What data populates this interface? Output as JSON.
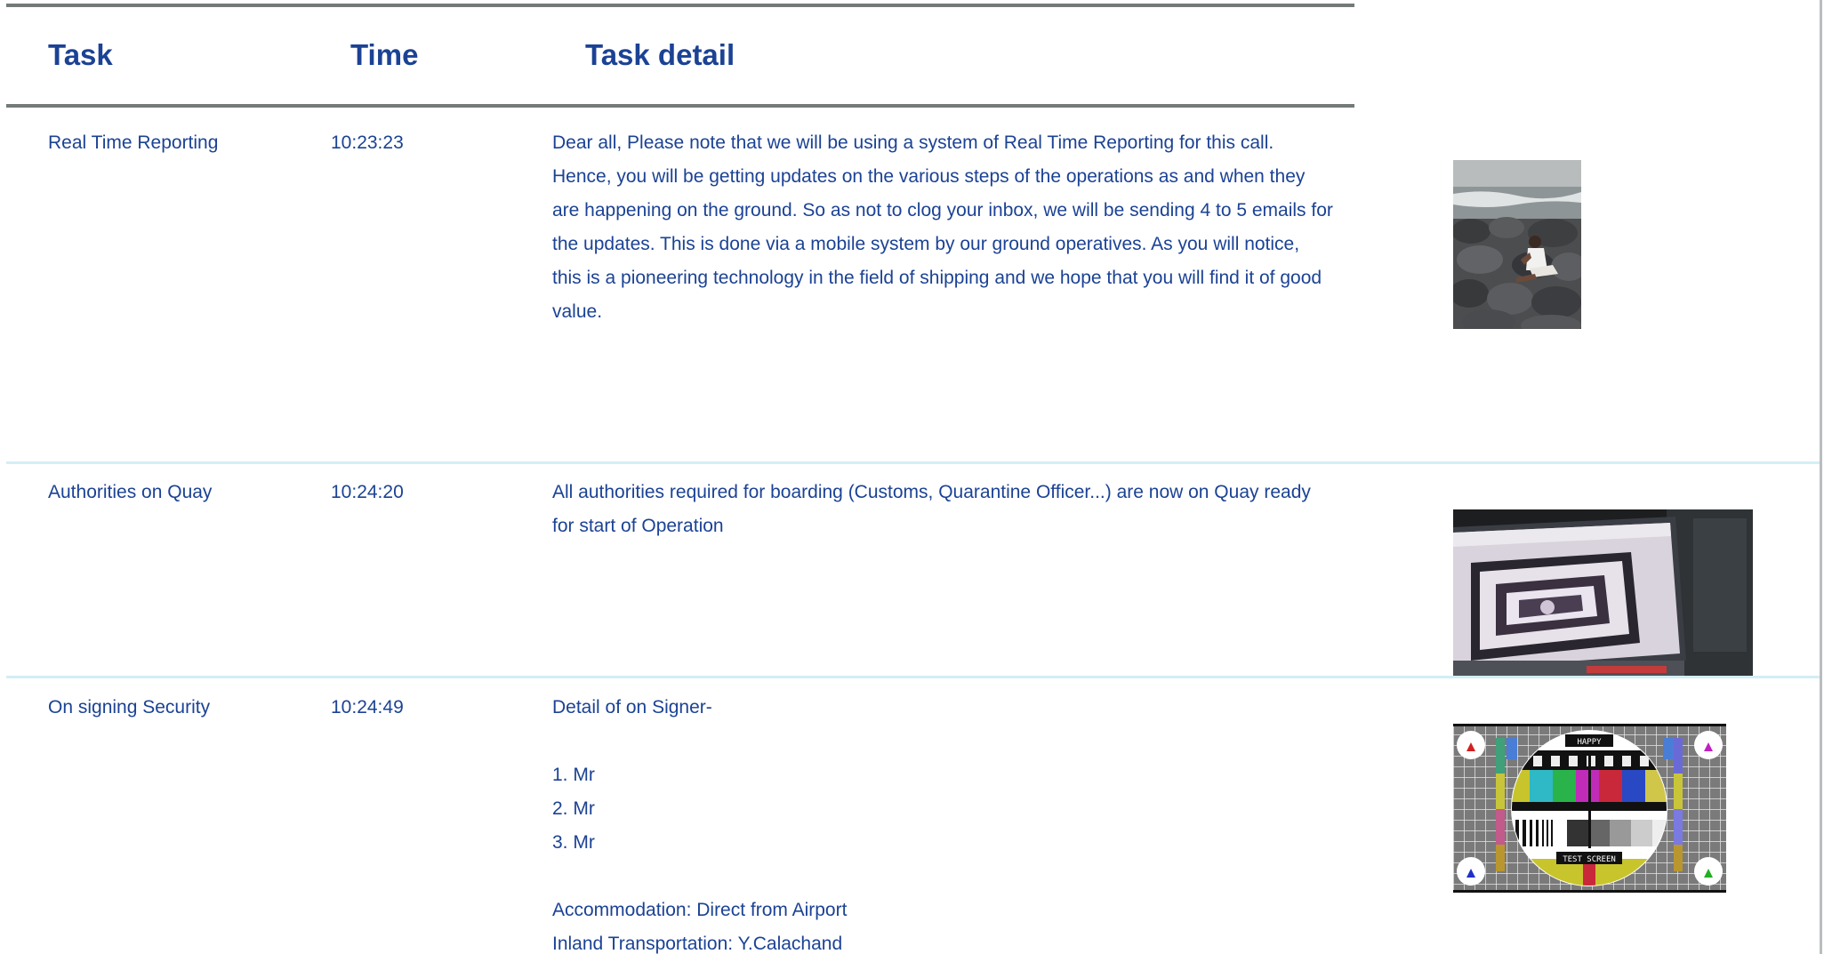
{
  "table": {
    "headers": {
      "task": "Task",
      "time": "Time",
      "detail": "Task detail"
    },
    "rows": [
      {
        "task": "Real Time Reporting",
        "time": "10:23:23",
        "detail_lines": [
          "Dear all, Please note that we will be using a system of Real Time Reporting for this call.",
          "Hence, you will be getting updates on the various steps of the operations as and when they",
          "are happening on the ground. So as not to clog your inbox, we will be sending 4 to 5 emails for",
          "the updates. This is done via a mobile system by our ground operatives. As you will notice,",
          "this is a pioneering technology in the  field of shipping and we hope that you will find it of good",
          "value."
        ],
        "photo": "photo-person-on-rocks-by-sea"
      },
      {
        "task": "Authorities on Quay",
        "time": "10:24:20",
        "detail_lines": [
          "All authorities required for boarding (Customs, Quarantine Officer...) are now on Quay ready",
          "for start of Operation"
        ],
        "photo": "photo-monitor-screen"
      },
      {
        "task": "On signing Security",
        "time": "10:24:49",
        "detail_lines": [
          "Detail of on Signer-",
          "",
          "1. Mr",
          "2. Mr",
          "3. Mr",
          "",
          "Accommodation: Direct from Airport",
          "Inland Transportation: Y.Calachand"
        ],
        "photo": "photo-tv-test-screen",
        "test_screen_top": "HAPPY",
        "test_screen_bottom": "TEST SCREEN"
      }
    ]
  },
  "colors": {
    "text": "#1b4294",
    "rule": "#737a79",
    "row_separator": "#d3eef6"
  }
}
